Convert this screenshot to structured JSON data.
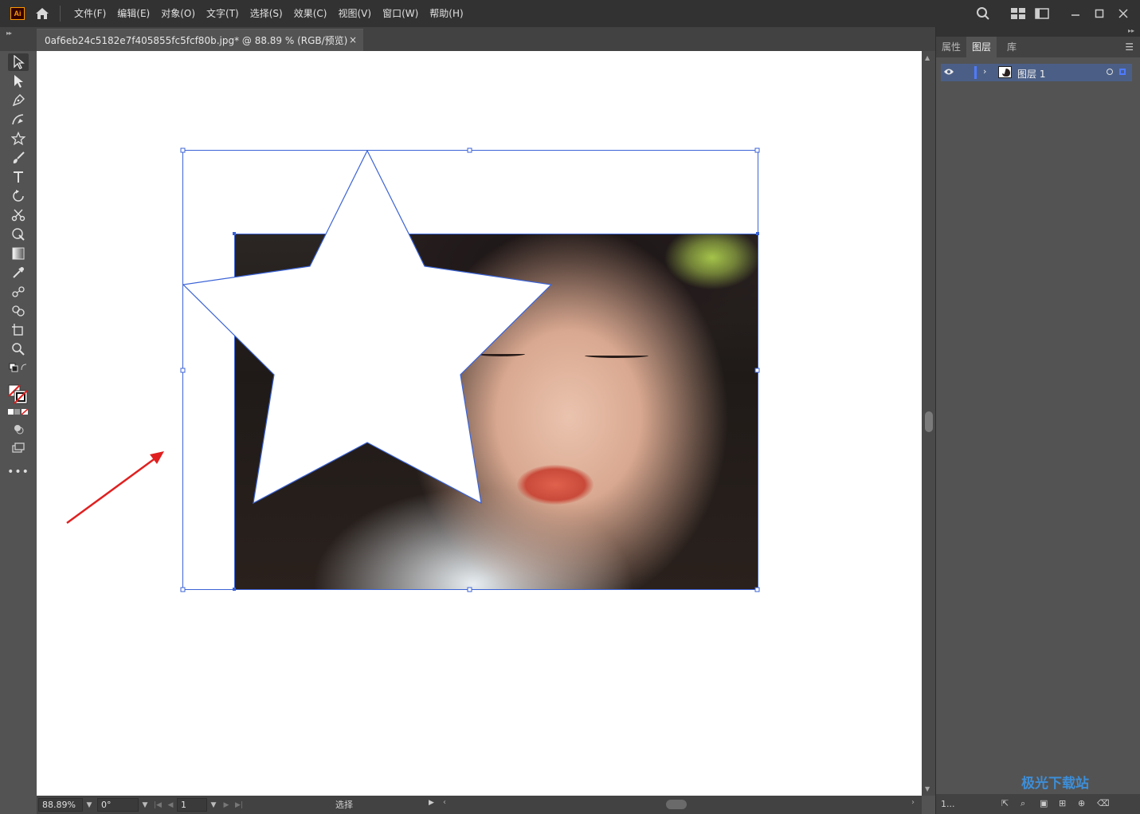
{
  "app": {
    "logo": "Ai"
  },
  "menu": [
    "文件(F)",
    "编辑(E)",
    "对象(O)",
    "文字(T)",
    "选择(S)",
    "效果(C)",
    "视图(V)",
    "窗口(W)",
    "帮助(H)"
  ],
  "document_tab": {
    "title": "0af6eb24c5182e7f405855fc5fcf80b.jpg* @ 88.89 % (RGB/预览)",
    "close": "×"
  },
  "status": {
    "zoom": "88.89%",
    "rotation": "0°",
    "artboard": "1",
    "mode": "选择"
  },
  "right_panel": {
    "tabs": [
      "属性",
      "图层",
      "库"
    ],
    "active_tab": "图层",
    "layer": {
      "name": "图层 1"
    },
    "layer_count": "1..."
  },
  "watermark": "极光下载站",
  "colors": {
    "accent": "#4f7bff",
    "selection": "#3b63d6",
    "arrow": "#e02020"
  },
  "icons": [
    "home-icon",
    "search-icon",
    "workspace-icon",
    "arrange-icon",
    "minimize-icon",
    "maximize-icon",
    "close-icon"
  ]
}
